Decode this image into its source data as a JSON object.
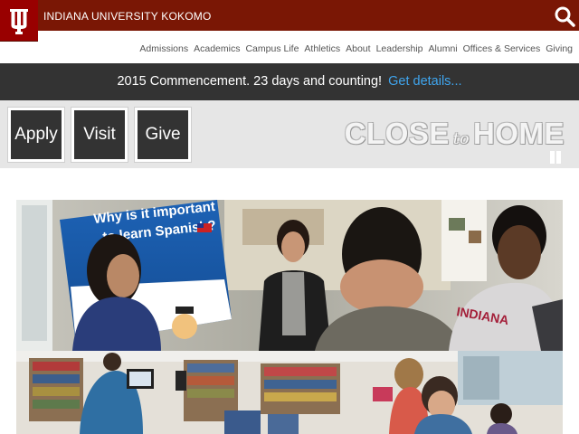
{
  "header": {
    "site_title": "INDIANA UNIVERSITY KOKOMO",
    "logo_icon": "iu-trident-icon",
    "search_icon": "search-icon",
    "brand_color": "#990000"
  },
  "nav": {
    "items": [
      "Admissions",
      "Academics",
      "Campus Life",
      "Athletics",
      "About",
      "Leadership",
      "Alumni",
      "Offices & Services",
      "Giving"
    ]
  },
  "announcement": {
    "text": "2015 Commencement. 23 days and counting!",
    "link_text": "Get details..."
  },
  "actions": {
    "apply": "Apply",
    "visit": "Visit",
    "give": "Give"
  },
  "tagline": {
    "left": "CLOSE",
    "middle": "to",
    "right": "HOME"
  },
  "slideshow": {
    "pause_icon": "pause-icon"
  },
  "poster": {
    "line1": "Why is it important",
    "line2": "to learn Spanish?"
  },
  "shirt_text": "INDIANA"
}
